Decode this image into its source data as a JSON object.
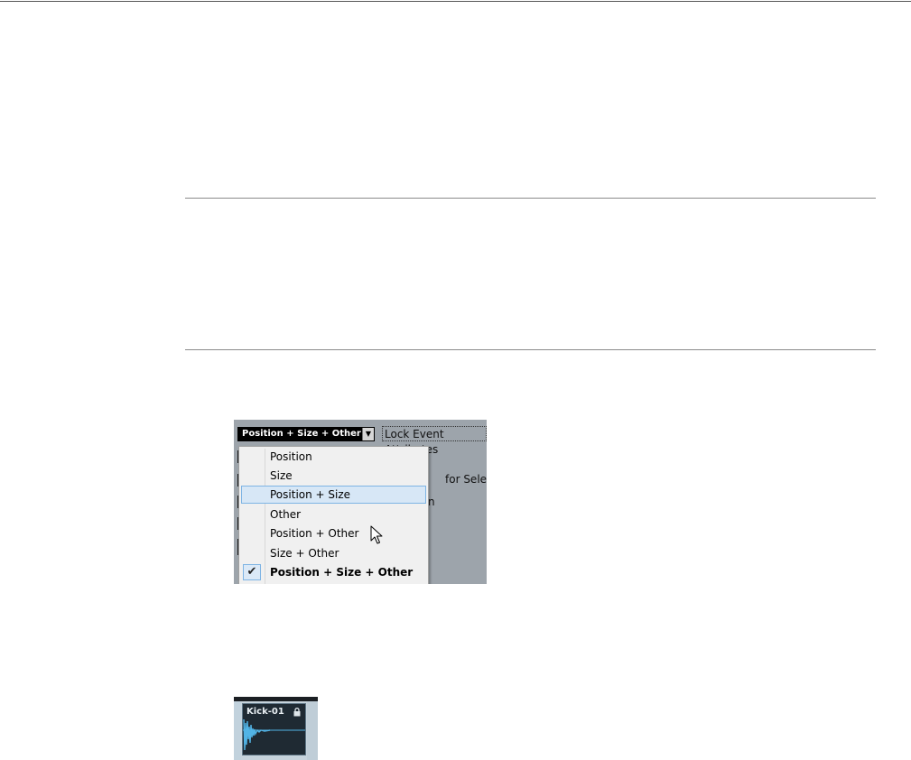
{
  "lock_menu": {
    "selected_value": "Position + Size + Other",
    "lock_button_label": "Lock Event Attributes",
    "background_text": [
      "for Selecting",
      "n"
    ],
    "items": [
      {
        "label": "Position",
        "checked": false,
        "highlighted": false
      },
      {
        "label": "Size",
        "checked": false,
        "highlighted": false
      },
      {
        "label": "Position + Size",
        "checked": false,
        "highlighted": true
      },
      {
        "label": "Other",
        "checked": false,
        "highlighted": false
      },
      {
        "label": "Position + Other",
        "checked": false,
        "highlighted": false
      },
      {
        "label": "Size + Other",
        "checked": false,
        "highlighted": false
      },
      {
        "label": "Position + Size + Other",
        "checked": true,
        "highlighted": false
      }
    ]
  },
  "event": {
    "name": "Kick-01",
    "locked": true,
    "icon": "lock-icon"
  },
  "colors": {
    "menu_highlight": "#d7e7f6",
    "menu_highlight_border": "#7eb4e4",
    "event_waveform": "#52b4e6"
  }
}
